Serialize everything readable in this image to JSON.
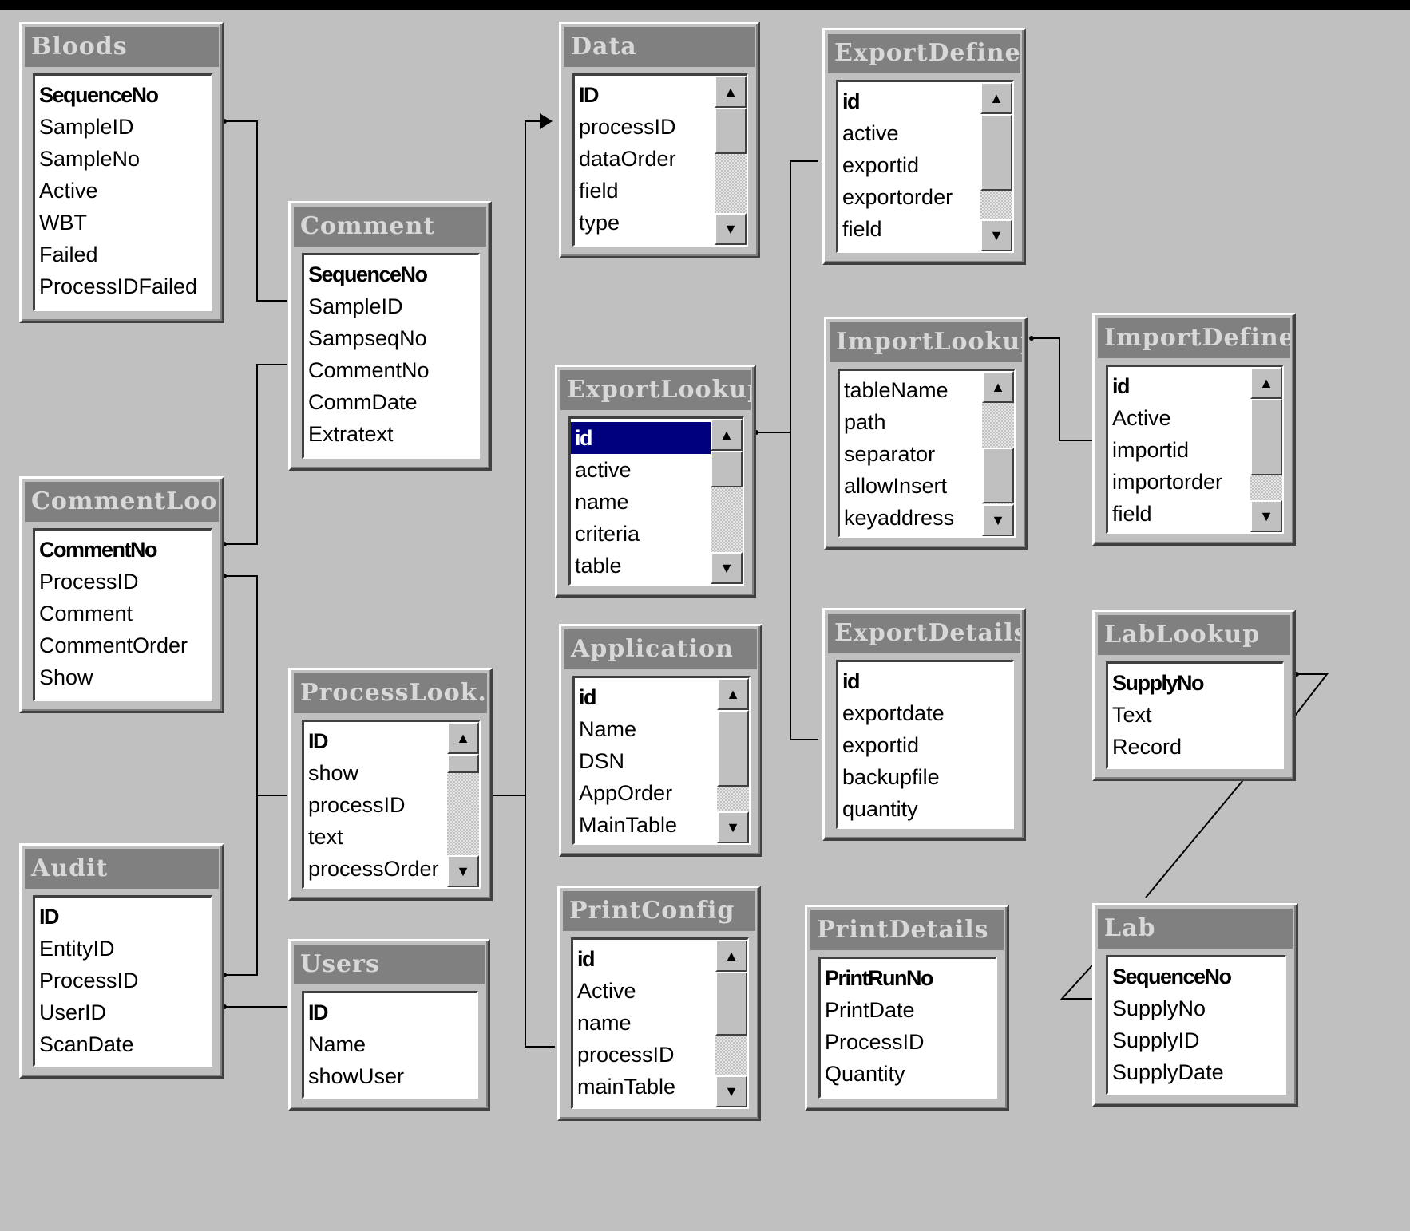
{
  "tables": {
    "bloods": {
      "title": "Bloods",
      "fields": [
        "SequenceNo",
        "SampleID",
        "SampleNo",
        "Active",
        "WBT",
        "Failed",
        "ProcessIDFailed"
      ]
    },
    "comment": {
      "title": "Comment",
      "fields": [
        "SequenceNo",
        "SampleID",
        "SampseqNo",
        "CommentNo",
        "CommDate",
        "Extratext"
      ]
    },
    "commentlookup": {
      "title": "CommentLoo...",
      "fields": [
        "CommentNo",
        "ProcessID",
        "Comment",
        "CommentOrder",
        "Show"
      ]
    },
    "audit": {
      "title": "Audit",
      "fields": [
        "ID",
        "EntityID",
        "ProcessID",
        "UserID",
        "ScanDate"
      ]
    },
    "processlookup": {
      "title": "ProcessLook...",
      "fields": [
        "ID",
        "show",
        "processID",
        "text",
        "processOrder"
      ]
    },
    "users": {
      "title": "Users",
      "fields": [
        "ID",
        "Name",
        "showUser"
      ]
    },
    "data": {
      "title": "Data",
      "fields": [
        "ID",
        "processID",
        "dataOrder",
        "field",
        "type"
      ]
    },
    "exportlookup": {
      "title": "ExportLookup",
      "fields": [
        "id",
        "active",
        "name",
        "criteria",
        "table"
      ]
    },
    "application": {
      "title": "Application",
      "fields": [
        "id",
        "Name",
        "DSN",
        "AppOrder",
        "MainTable"
      ]
    },
    "printconfig": {
      "title": "PrintConfig",
      "fields": [
        "id",
        "Active",
        "name",
        "processID",
        "mainTable"
      ]
    },
    "exportdefine": {
      "title": "ExportDefine",
      "fields": [
        "id",
        "active",
        "exportid",
        "exportorder",
        "field"
      ]
    },
    "importlookup": {
      "title": "ImportLookup",
      "fields": [
        "tableName",
        "path",
        "separator",
        "allowInsert",
        "keyaddress"
      ]
    },
    "exportdetails": {
      "title": "ExportDetails",
      "fields": [
        "id",
        "exportdate",
        "exportid",
        "backupfile",
        "quantity"
      ]
    },
    "printdetails": {
      "title": "PrintDetails",
      "fields": [
        "PrintRunNo",
        "PrintDate",
        "ProcessID",
        "Quantity"
      ]
    },
    "importdefine": {
      "title": "ImportDefine",
      "fields": [
        "id",
        "Active",
        "importid",
        "importorder",
        "field"
      ]
    },
    "lablookup": {
      "title": "LabLookup",
      "fields": [
        "SupplyNo",
        "Text",
        "Record"
      ]
    },
    "lab": {
      "title": "Lab",
      "fields": [
        "SequenceNo",
        "SupplyNo",
        "SupplyID",
        "SupplyDate"
      ]
    }
  },
  "selected_field": "exportlookup.id",
  "colors": {
    "background": "#c0c0c0",
    "title_bar": "#808080",
    "selection": "#00007f"
  }
}
